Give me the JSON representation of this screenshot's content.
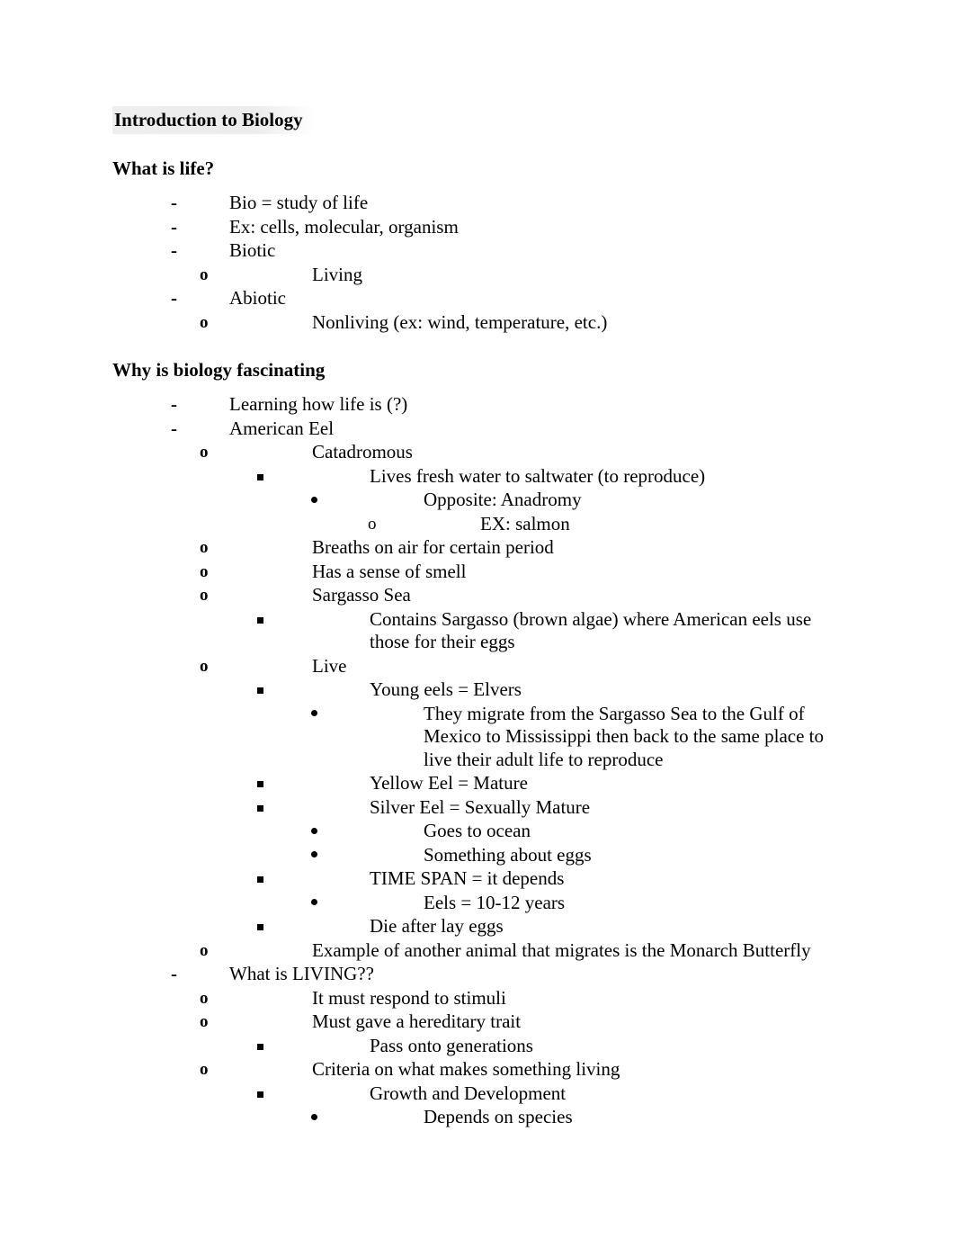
{
  "document": {
    "title": "Introduction to Biology",
    "title_highlighted": true,
    "highlight_color": "#ebebeb",
    "text_color": "#000000",
    "background_color": "#ffffff"
  },
  "sections": [
    {
      "heading": "What is life?",
      "items": [
        {
          "level": 1,
          "bullet": "hyphen",
          "text": "Bio = study of life"
        },
        {
          "level": 1,
          "bullet": "hyphen",
          "text": "Ex: cells, molecular, organism"
        },
        {
          "level": 1,
          "bullet": "hyphen",
          "text": "Biotic"
        },
        {
          "level": 2,
          "bullet": "letter-o-bold",
          "text": "Living"
        },
        {
          "level": 1,
          "bullet": "hyphen",
          "text": "Abiotic"
        },
        {
          "level": 2,
          "bullet": "letter-o-bold",
          "text": "Nonliving (ex: wind, temperature, etc.)"
        }
      ]
    },
    {
      "heading": "Why is biology fascinating",
      "items": [
        {
          "level": 1,
          "bullet": "hyphen",
          "text": "Learning how life is (?)"
        },
        {
          "level": 1,
          "bullet": "hyphen",
          "text": "American Eel"
        },
        {
          "level": 2,
          "bullet": "letter-o-bold",
          "text": "Catadromous"
        },
        {
          "level": 3,
          "bullet": "square",
          "text": "Lives fresh water to saltwater (to reproduce)"
        },
        {
          "level": 4,
          "bullet": "round",
          "text": "Opposite: Anadromy"
        },
        {
          "level": 5,
          "bullet": "letter-o",
          "text": "EX: salmon"
        },
        {
          "level": 2,
          "bullet": "letter-o-bold",
          "text": "Breaths on air for certain period"
        },
        {
          "level": 2,
          "bullet": "letter-o-bold",
          "text": "Has a sense of smell"
        },
        {
          "level": 2,
          "bullet": "letter-o-bold",
          "text": "Sargasso Sea"
        },
        {
          "level": 3,
          "bullet": "square",
          "text": "Contains Sargasso (brown algae) where American eels use those for their eggs"
        },
        {
          "level": 2,
          "bullet": "letter-o-bold",
          "text": "Live"
        },
        {
          "level": 3,
          "bullet": "square",
          "text": "Young eels = Elvers"
        },
        {
          "level": 4,
          "bullet": "round",
          "text": "They migrate from the Sargasso Sea to the Gulf of Mexico to Mississippi then back to the same place to live their adult life to reproduce"
        },
        {
          "level": 3,
          "bullet": "square",
          "text": "Yellow Eel = Mature"
        },
        {
          "level": 3,
          "bullet": "square",
          "text": "Silver Eel = Sexually Mature"
        },
        {
          "level": 4,
          "bullet": "round",
          "text": "Goes to ocean"
        },
        {
          "level": 4,
          "bullet": "round",
          "text": "Something about eggs"
        },
        {
          "level": 3,
          "bullet": "square",
          "text": "TIME SPAN = it depends"
        },
        {
          "level": 4,
          "bullet": "round",
          "text": "Eels = 10-12 years"
        },
        {
          "level": 3,
          "bullet": "square",
          "text": "Die after lay eggs"
        },
        {
          "level": 2,
          "bullet": "letter-o-bold",
          "text": "Example of another animal that migrates is the Monarch Butterfly"
        },
        {
          "level": 1,
          "bullet": "hyphen",
          "text": "What is LIVING??"
        },
        {
          "level": 2,
          "bullet": "letter-o-bold",
          "text": "It must respond to stimuli"
        },
        {
          "level": 2,
          "bullet": "letter-o-bold",
          "text": "Must gave a hereditary trait"
        },
        {
          "level": 3,
          "bullet": "square",
          "text": "Pass onto generations"
        },
        {
          "level": 2,
          "bullet": "letter-o-bold",
          "text": "Criteria on what makes something living"
        },
        {
          "level": 3,
          "bullet": "square",
          "text": "Growth and Development"
        },
        {
          "level": 4,
          "bullet": "round",
          "text": "Depends on species"
        }
      ]
    }
  ],
  "bullet_glyphs": {
    "hyphen": "-",
    "letter-o-bold": "o",
    "letter-o": "o",
    "square": "",
    "round": ""
  }
}
